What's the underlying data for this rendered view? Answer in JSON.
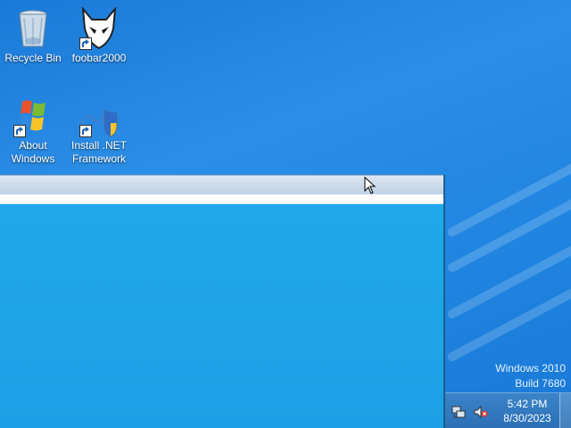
{
  "desktop": {
    "icons": [
      {
        "label": "Recycle Bin",
        "icon": "recycle-bin-icon"
      },
      {
        "label": "foobar2000",
        "icon": "foobar2000-icon"
      },
      {
        "label": "About Windows",
        "icon": "windows-flag-icon"
      },
      {
        "label": "Install .NET Framework",
        "icon": "dotnet-installer-icon"
      }
    ]
  },
  "watermark": {
    "line1": "Windows 2010",
    "line2": "Build 7680"
  },
  "taskbar": {
    "clock_time": "5:42 PM",
    "clock_date": "8/30/2023"
  }
}
